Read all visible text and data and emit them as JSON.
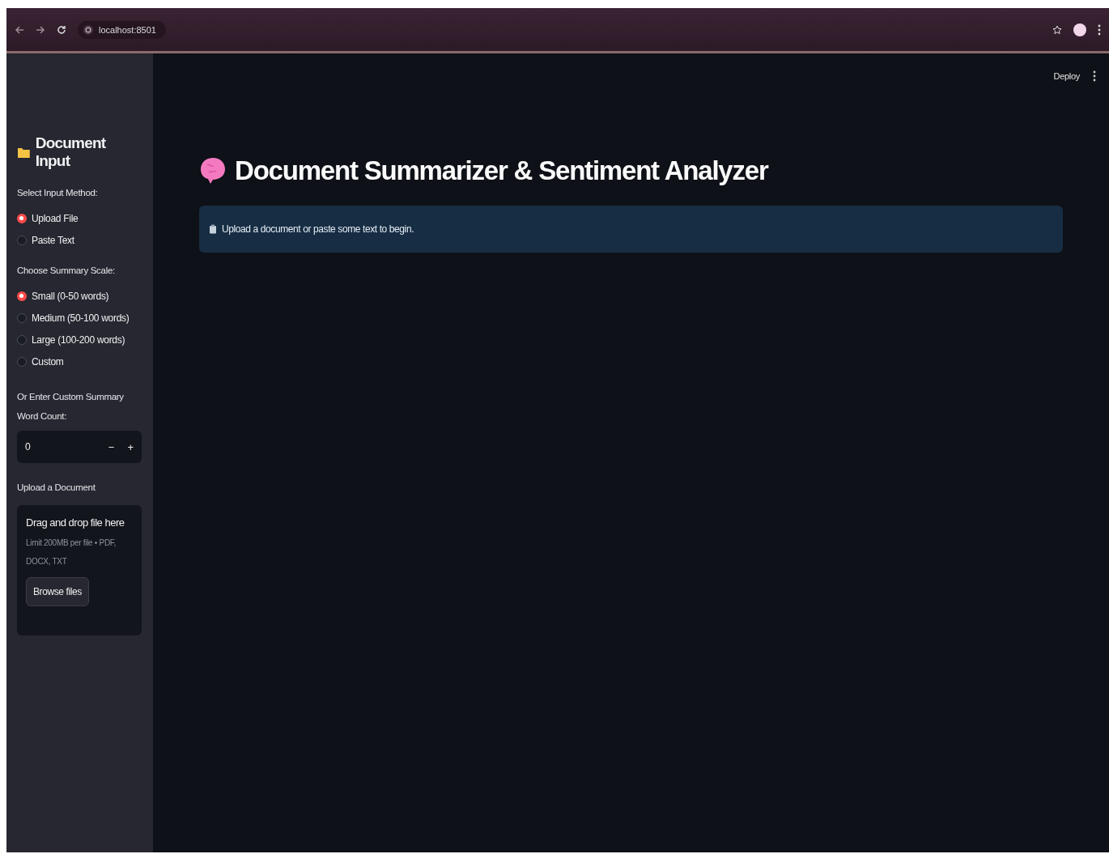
{
  "browser": {
    "url": "localhost:8501"
  },
  "header": {
    "deploy": "Deploy"
  },
  "sidebar": {
    "title": "Document Input",
    "input_method": {
      "label": "Select Input Method:",
      "options": [
        {
          "label": "Upload File",
          "selected": true
        },
        {
          "label": "Paste Text",
          "selected": false
        }
      ]
    },
    "summary_scale": {
      "label": "Choose Summary Scale:",
      "options": [
        {
          "label": "Small (0-50 words)",
          "selected": true
        },
        {
          "label": "Medium (50-100 words)",
          "selected": false
        },
        {
          "label": "Large (100-200 words)",
          "selected": false
        },
        {
          "label": "Custom",
          "selected": false
        }
      ]
    },
    "custom_count": {
      "label": "Or Enter Custom Summary Word Count:",
      "value": "0",
      "decrement": "−",
      "increment": "+"
    },
    "upload": {
      "label": "Upload a Document",
      "drop_text": "Drag and drop file here",
      "limit_text": "Limit 200MB per file • PDF, DOCX, TXT",
      "button": "Browse files"
    }
  },
  "main": {
    "title": "Document Summarizer & Sentiment Analyzer",
    "info": "Upload a document or paste some text to begin."
  }
}
